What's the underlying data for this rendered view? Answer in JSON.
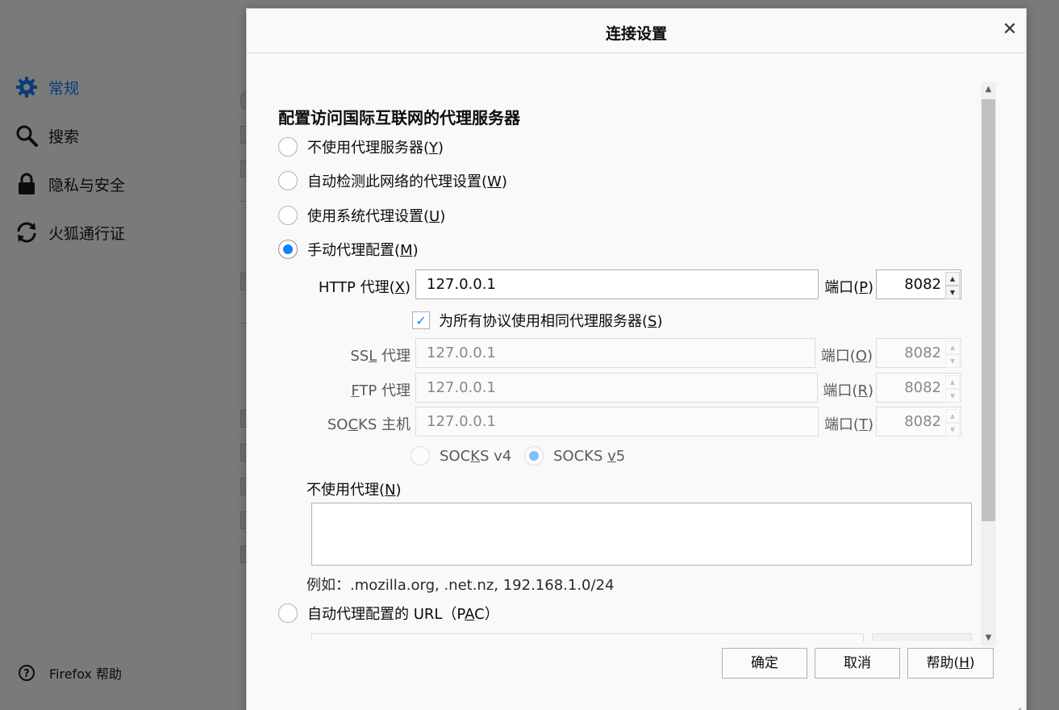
{
  "sidebar": {
    "items": [
      {
        "label": "常规",
        "icon": "gear-icon",
        "active": true
      },
      {
        "label": "搜索",
        "icon": "search-icon",
        "active": false
      },
      {
        "label": "隐私与安全",
        "icon": "lock-icon",
        "active": false
      },
      {
        "label": "火狐通行证",
        "icon": "sync-icon",
        "active": false
      }
    ],
    "help_label": "Firefox 帮助"
  },
  "dialog": {
    "title": "连接设置",
    "section_title": "配置访问国际互联网的代理服务器",
    "options": {
      "no_proxy": {
        "text": "不使用代理服务器(",
        "key": "Y",
        "end": ")"
      },
      "auto_detect": {
        "text": "自动检测此网络的代理设置(",
        "key": "W",
        "end": ")"
      },
      "system_proxy": {
        "text": "使用系统代理设置(",
        "key": "U",
        "end": ")"
      },
      "manual_proxy": {
        "text": "手动代理配置(",
        "key": "M",
        "end": ")"
      },
      "pac": {
        "text": "自动代理配置的 URL（P",
        "key": "A",
        "end": "C）"
      }
    },
    "http": {
      "label_pre": "HTTP 代理(",
      "key": "X",
      "label_post": ")",
      "value": "127.0.0.1",
      "port_pre": "端口(",
      "port_key": "P",
      "port_post": ")",
      "port": "8082"
    },
    "same_proxy": {
      "text": "为所有协议使用相同代理服务器(",
      "key": "S",
      "end": ")",
      "checked": true
    },
    "ssl": {
      "label_pre": "SS",
      "key": "L",
      "label_post": " 代理",
      "value": "127.0.0.1",
      "port_pre": "端口(",
      "port_key": "O",
      "port_post": ")",
      "port": "8082"
    },
    "ftp": {
      "label_pre": "",
      "key": "F",
      "label_post": "TP 代理",
      "value": "127.0.0.1",
      "port_pre": "端口(",
      "port_key": "R",
      "port_post": ")",
      "port": "8082"
    },
    "socks": {
      "label_pre": "SO",
      "key": "C",
      "label_post": "KS 主机",
      "value": "127.0.0.1",
      "port_pre": "端口(",
      "port_key": "T",
      "port_post": ")",
      "port": "8082"
    },
    "socks_v4": {
      "pre": "SOC",
      "key": "K",
      "post": "S v4"
    },
    "socks_v5": {
      "pre": "SOCKS ",
      "key": "v",
      "post": "5"
    },
    "no_proxy_for": {
      "text": "不使用代理(",
      "key": "N",
      "end": ")"
    },
    "example": "例如：.mozilla.org, .net.nz, 192.168.1.0/24",
    "buttons": {
      "ok": "确定",
      "cancel": "取消",
      "help_pre": "帮助(",
      "help_key": "H",
      "help_post": ")"
    }
  },
  "colors": {
    "accent": "#0a84ff",
    "nav_active": "#0a3c7a"
  }
}
